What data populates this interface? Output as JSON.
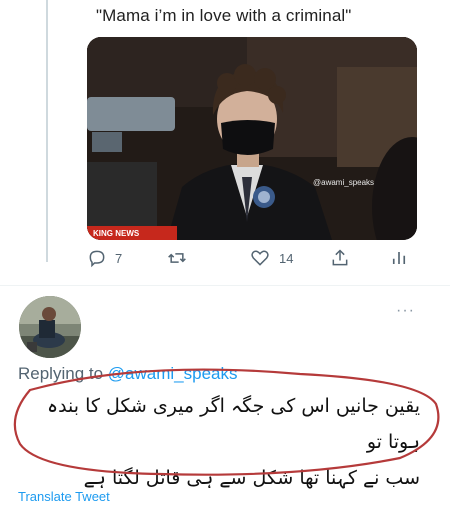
{
  "quoted_tweet": {
    "text": "\"Mama i’m in love with a criminal\"",
    "media": {
      "watermark": "@awami_speaks",
      "news_ticker": "KING NEWS"
    },
    "actions": {
      "reply_count": "7",
      "like_count": "14",
      "retweet_count": "",
      "icons": [
        "comment-icon",
        "retweet-icon",
        "heart-icon",
        "share-icon",
        "analytics-icon"
      ]
    }
  },
  "reply": {
    "more_menu": "···",
    "replying_prefix": "Replying to",
    "replying_handle": "@awami_speaks",
    "body_line1": "یقین جانیں اس کی جگہ اگر میری شکل کا بندہ ہوتا تو",
    "body_line2": "سب نے کہنا تھا شکل سے ہی قاتل لگتا ہے",
    "translate_label": "Translate Tweet"
  },
  "colors": {
    "link_blue": "#1d9bf0",
    "muted_gray": "#536471",
    "annotation_red": "#b53a3a"
  }
}
